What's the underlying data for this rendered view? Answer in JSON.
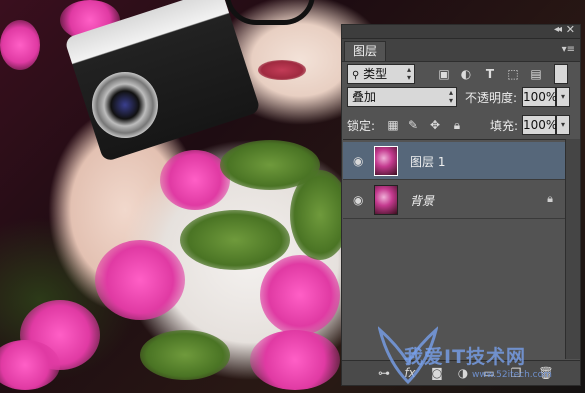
{
  "panel": {
    "tab_label": "图层",
    "filter_kind": "类型",
    "blend_mode": "叠加",
    "opacity_label": "不透明度:",
    "opacity_value": "100%",
    "lock_label": "锁定:",
    "fill_label": "填充:",
    "fill_value": "100%",
    "collapse_glyph": "◂◂",
    "close_glyph": "✕",
    "menu_glyph": "▾≡"
  },
  "layers": [
    {
      "name": "图层 1",
      "selected": true,
      "locked": false
    },
    {
      "name": "背景",
      "selected": false,
      "locked": true
    }
  ],
  "filter_icons": [
    "image-filter-icon",
    "adjustment-filter-icon",
    "type-filter-icon",
    "shape-filter-icon",
    "smart-object-filter-icon"
  ],
  "lock_icons": [
    "lock-transparent-icon",
    "lock-paint-icon",
    "lock-position-icon",
    "lock-all-icon"
  ],
  "bottom_icons": [
    "link-layers-icon",
    "fx-icon",
    "mask-icon",
    "adjustment-layer-icon",
    "group-icon",
    "new-layer-icon",
    "delete-layer-icon"
  ],
  "watermark": {
    "text": "我爱IT技术网",
    "sub": "www.52itech.com"
  },
  "colors": {
    "panel_bg": "#535353",
    "selected_layer": "#56677a",
    "watermark": "#78a0eb"
  }
}
